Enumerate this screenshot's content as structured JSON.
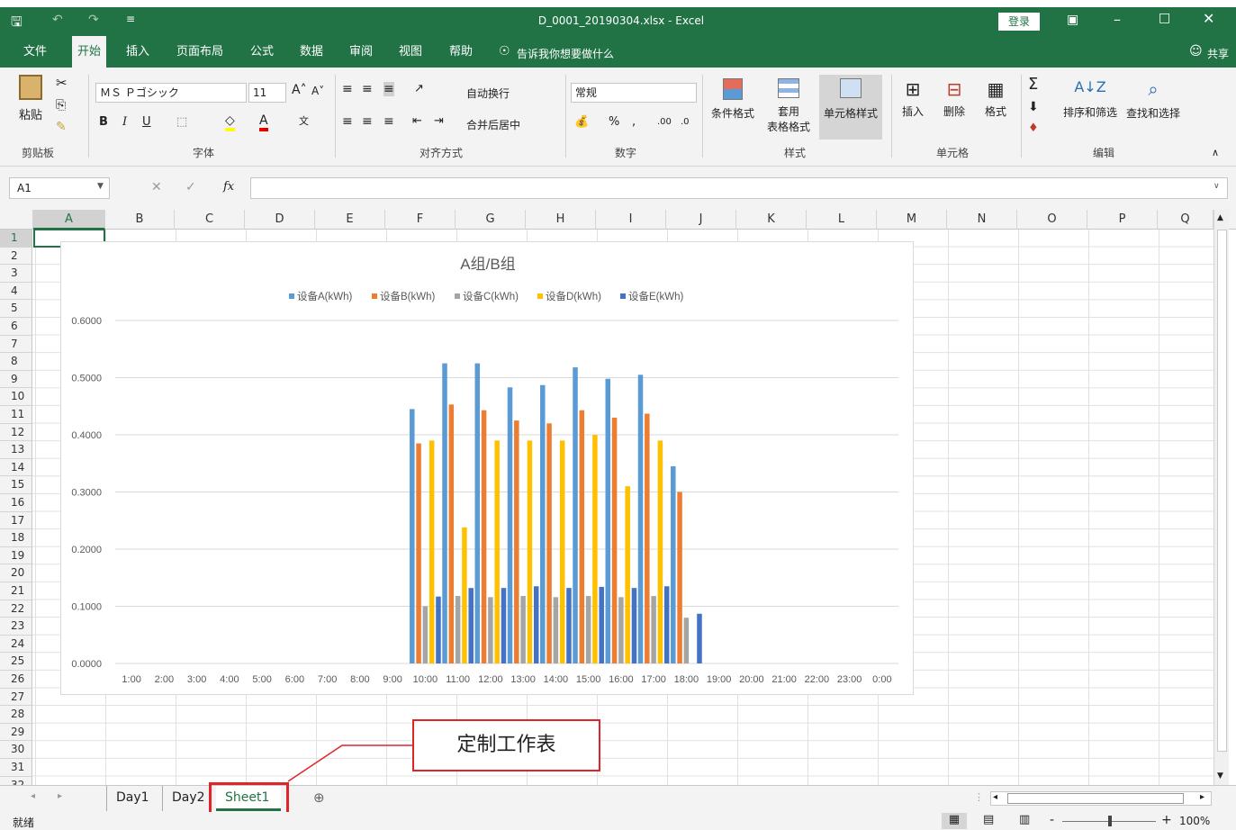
{
  "window": {
    "title": "D_0001_20190304.xlsx  -  Excel",
    "login": "登录"
  },
  "ribbon_tabs": [
    "文件",
    "开始",
    "插入",
    "页面布局",
    "公式",
    "数据",
    "审阅",
    "视图",
    "帮助"
  ],
  "tell_me": "告诉我你想要做什么",
  "share": "共享",
  "ribbon": {
    "paste": "粘贴",
    "clipboard": "剪贴板",
    "font_name": "ＭＳ Ｐゴシック",
    "font_size": "11",
    "font_group": "字体",
    "wrap_text": "自动换行",
    "merge_center": "合并后居中",
    "align_group": "对齐方式",
    "number_format": "常规",
    "number_group": "数字",
    "cond_format": "条件格式",
    "table_format_1": "套用",
    "table_format_2": "表格格式",
    "cell_styles": "单元格样式",
    "styles_group": "样式",
    "insert": "插入",
    "delete": "删除",
    "format": "格式",
    "cells_group": "单元格",
    "sort_filter": "排序和筛选",
    "find_select": "查找和选择",
    "editing_group": "编辑"
  },
  "formula": {
    "name_box": "A1",
    "fx": "fx"
  },
  "columns": [
    "A",
    "B",
    "C",
    "D",
    "E",
    "F",
    "G",
    "H",
    "I",
    "J",
    "K",
    "L",
    "M",
    "N",
    "O",
    "P",
    "Q"
  ],
  "rows": [
    "1",
    "2",
    "3",
    "4",
    "5",
    "6",
    "7",
    "8",
    "9",
    "10",
    "11",
    "12",
    "13",
    "14",
    "15",
    "16",
    "17",
    "18",
    "19",
    "20",
    "21",
    "22",
    "23",
    "24",
    "25",
    "26",
    "27",
    "28",
    "29",
    "30",
    "31",
    "32"
  ],
  "chart_data": {
    "type": "bar",
    "title": "A组/B组",
    "categories": [
      "1:00",
      "2:00",
      "3:00",
      "4:00",
      "5:00",
      "6:00",
      "7:00",
      "8:00",
      "9:00",
      "10:00",
      "11:00",
      "12:00",
      "13:00",
      "14:00",
      "15:00",
      "16:00",
      "17:00",
      "18:00",
      "19:00",
      "20:00",
      "21:00",
      "22:00",
      "23:00",
      "0:00"
    ],
    "yticks": [
      "0.0000",
      "0.1000",
      "0.2000",
      "0.3000",
      "0.4000",
      "0.5000",
      "0.6000"
    ],
    "ylim": [
      0,
      0.6
    ],
    "legend_position": "top",
    "grid": true,
    "series": [
      {
        "name": "设备A(kWh)",
        "color": "#5b9bd5",
        "values": [
          null,
          null,
          null,
          null,
          null,
          null,
          null,
          null,
          null,
          0.445,
          0.525,
          0.525,
          0.483,
          0.487,
          0.518,
          0.498,
          0.505,
          0.345,
          null,
          null,
          null,
          null,
          null,
          null
        ]
      },
      {
        "name": "设备B(kWh)",
        "color": "#ed7d31",
        "values": [
          null,
          null,
          null,
          null,
          null,
          null,
          null,
          null,
          null,
          0.385,
          0.453,
          0.443,
          0.425,
          0.42,
          0.443,
          0.43,
          0.437,
          0.3,
          null,
          null,
          null,
          null,
          null,
          null
        ]
      },
      {
        "name": "设备C(kWh)",
        "color": "#a5a5a5",
        "values": [
          null,
          null,
          null,
          null,
          null,
          null,
          null,
          null,
          null,
          0.1,
          0.118,
          0.116,
          0.118,
          0.116,
          0.118,
          0.116,
          0.118,
          0.08,
          null,
          null,
          null,
          null,
          null,
          null
        ]
      },
      {
        "name": "设备D(kWh)",
        "color": "#ffc000",
        "values": [
          null,
          null,
          null,
          null,
          null,
          null,
          null,
          null,
          null,
          0.39,
          0.238,
          0.39,
          0.39,
          0.39,
          0.4,
          0.31,
          0.39,
          null,
          null,
          null,
          null,
          null,
          null,
          null
        ]
      },
      {
        "name": "设备E(kWh)",
        "color": "#4472c4",
        "values": [
          null,
          null,
          null,
          null,
          null,
          null,
          null,
          null,
          null,
          0.117,
          0.132,
          0.132,
          0.135,
          0.132,
          0.134,
          0.132,
          0.135,
          0.087,
          null,
          null,
          null,
          null,
          null,
          null
        ]
      }
    ]
  },
  "sheets": [
    "Day1",
    "Day2",
    "Sheet1"
  ],
  "active_sheet": "Sheet1",
  "callout": "定制工作表",
  "status": {
    "ready": "就绪",
    "zoom": "100%"
  }
}
